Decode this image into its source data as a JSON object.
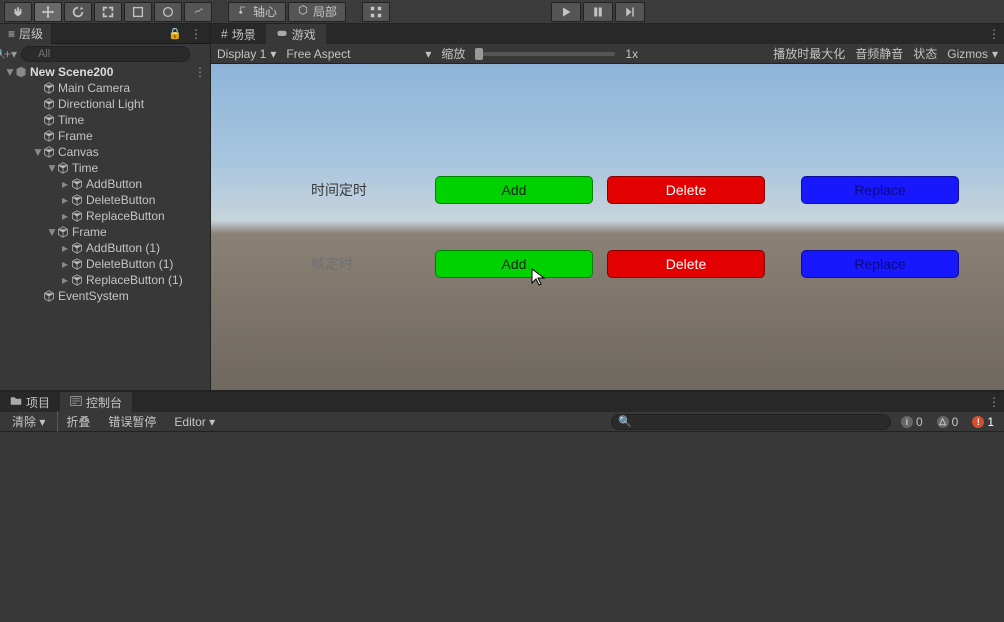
{
  "toolbar": {
    "pivot_label": "轴心",
    "local_label": "局部"
  },
  "hierarchy": {
    "title": "层级",
    "search_placeholder": "All",
    "scene": "New Scene200",
    "items": [
      {
        "label": "Main Camera",
        "indent": 2,
        "expandable": false
      },
      {
        "label": "Directional Light",
        "indent": 2,
        "expandable": false
      },
      {
        "label": "Time",
        "indent": 2,
        "expandable": false
      },
      {
        "label": "Frame",
        "indent": 2,
        "expandable": false
      },
      {
        "label": "Canvas",
        "indent": 2,
        "expandable": true,
        "expanded": true
      },
      {
        "label": "Time",
        "indent": 3,
        "expandable": true,
        "expanded": true
      },
      {
        "label": "AddButton",
        "indent": 4,
        "expandable": true,
        "expanded": false
      },
      {
        "label": "DeleteButton",
        "indent": 4,
        "expandable": true,
        "expanded": false
      },
      {
        "label": "ReplaceButton",
        "indent": 4,
        "expandable": true,
        "expanded": false
      },
      {
        "label": "Frame",
        "indent": 3,
        "expandable": true,
        "expanded": true
      },
      {
        "label": "AddButton (1)",
        "indent": 4,
        "expandable": true,
        "expanded": false
      },
      {
        "label": "DeleteButton (1)",
        "indent": 4,
        "expandable": true,
        "expanded": false
      },
      {
        "label": "ReplaceButton (1)",
        "indent": 4,
        "expandable": true,
        "expanded": false
      },
      {
        "label": "EventSystem",
        "indent": 2,
        "expandable": false
      }
    ]
  },
  "game": {
    "scene_tab": "场景",
    "game_tab": "游戏",
    "display": "Display 1",
    "aspect": "Free Aspect",
    "scale_label": "缩放",
    "scale_value": "1x",
    "max_on_play": "播放时最大化",
    "mute_audio": "音频静音",
    "stats": "状态",
    "gizmos": "Gizmos",
    "row1_label": "时间定时",
    "row2_label": "帧定时",
    "add": "Add",
    "delete": "Delete",
    "replace": "Replace"
  },
  "bottom": {
    "project_tab": "项目",
    "console_tab": "控制台",
    "clear": "清除",
    "collapse": "折叠",
    "error_pause": "错误暂停",
    "editor": "Editor",
    "info_count": "0",
    "warn_count": "0",
    "error_count": "1"
  }
}
